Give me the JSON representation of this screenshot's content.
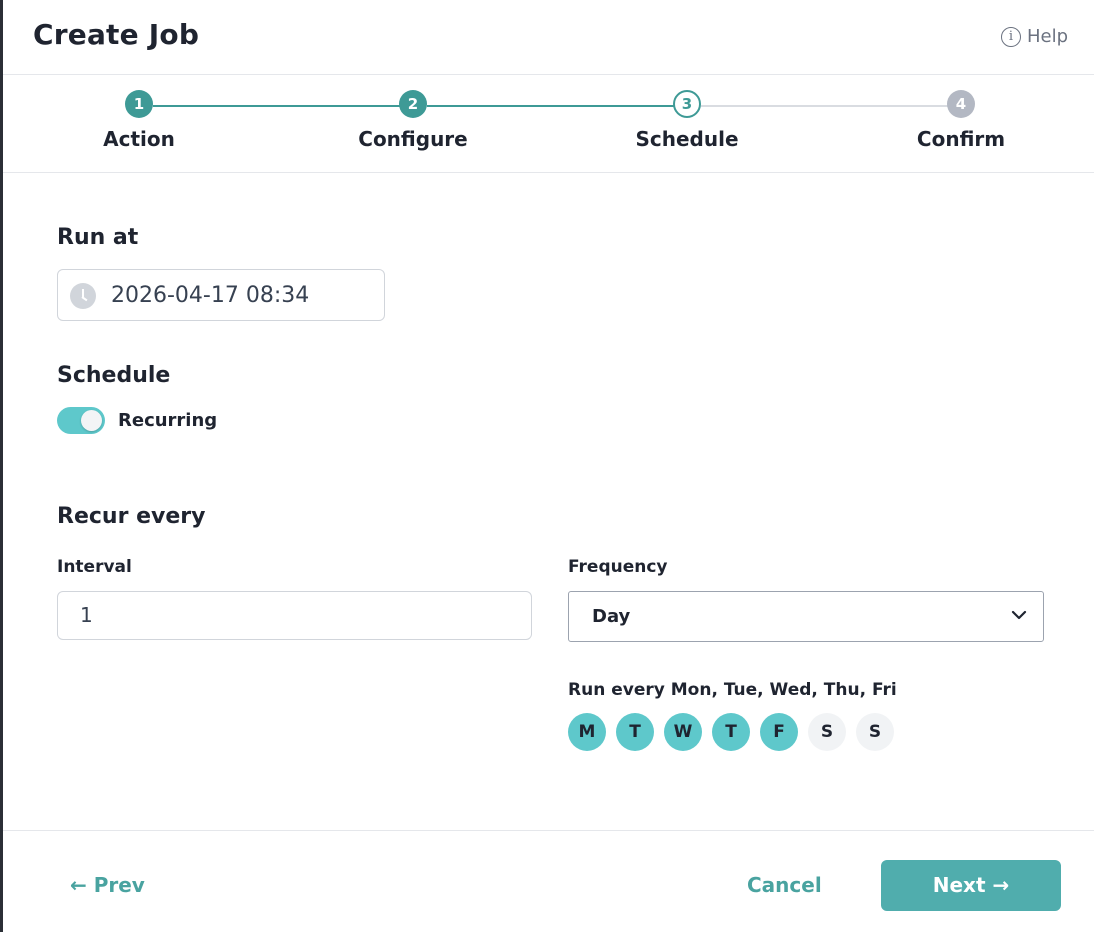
{
  "dialog": {
    "title": "Create Job",
    "help_label": "Help",
    "help_icon_glyph": "i"
  },
  "stepper": {
    "steps": [
      {
        "number": "1",
        "label": "Action",
        "state": "done"
      },
      {
        "number": "2",
        "label": "Configure",
        "state": "done"
      },
      {
        "number": "3",
        "label": "Schedule",
        "state": "current"
      },
      {
        "number": "4",
        "label": "Confirm",
        "state": "todo"
      }
    ]
  },
  "run_at": {
    "label": "Run at",
    "value": "2026-04-17 08:34",
    "icon": "clock-icon"
  },
  "schedule": {
    "label": "Schedule",
    "recurring_label": "Recurring",
    "recurring_on": true
  },
  "recur": {
    "label": "Recur every",
    "interval_label": "Interval",
    "interval_value": "1",
    "frequency_label": "Frequency",
    "frequency_value": "Day",
    "run_every_text": "Run every Mon, Tue, Wed, Thu, Fri",
    "days": [
      {
        "letter": "M",
        "selected": true
      },
      {
        "letter": "T",
        "selected": true
      },
      {
        "letter": "W",
        "selected": true
      },
      {
        "letter": "T",
        "selected": true
      },
      {
        "letter": "F",
        "selected": true
      },
      {
        "letter": "S",
        "selected": false
      },
      {
        "letter": "S",
        "selected": false
      }
    ]
  },
  "footer": {
    "prev_label": "← Prev",
    "cancel_label": "Cancel",
    "next_label": "Next →"
  },
  "colors": {
    "accent": "#3e9a96",
    "toggle": "#5ec8cb",
    "next_button": "#50adad",
    "pending_step": "#b3b8c3"
  }
}
